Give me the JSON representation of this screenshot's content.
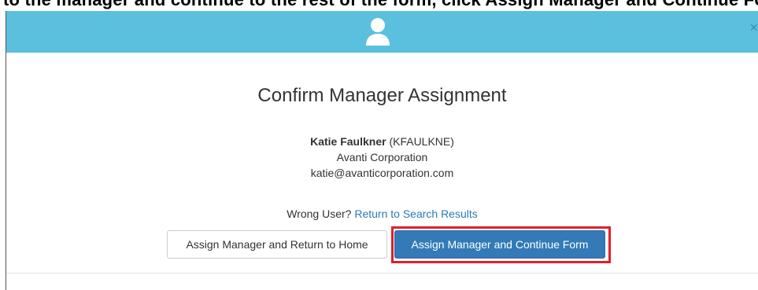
{
  "background_instruction": "to the manager and continue to the rest of the form, click Assign Manager and Continue Form",
  "modal": {
    "header_color": "#5bc0de",
    "header_icon": "user-icon",
    "close_symbol": "×",
    "title": "Confirm Manager Assignment",
    "user": {
      "name": "Katie Faulkner",
      "username": "(KFAULKNE)",
      "company": "Avanti Corporation",
      "email": "katie@avanticorporation.com"
    },
    "wrong_user_text": "Wrong User?",
    "return_link": "Return to Search Results",
    "buttons": {
      "home": "Assign Manager and Return to Home",
      "continue": "Assign Manager and Continue Form"
    },
    "primary_color": "#337ab7",
    "highlight_color": "#e0202a"
  }
}
